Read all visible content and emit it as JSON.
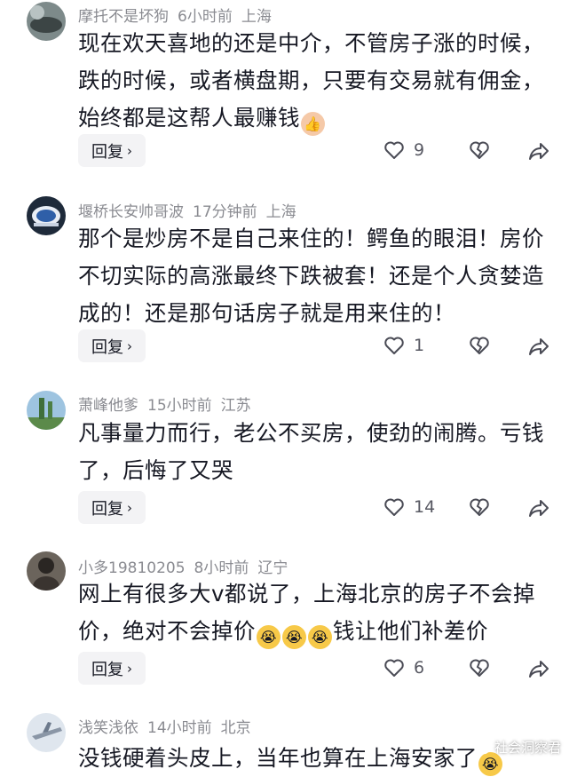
{
  "comments": [
    {
      "username": "摩托不是坏狗",
      "time": "6小时前",
      "location": "上海",
      "text": "现在欢天喜地的还是中介，不管房子涨的时候，跌的时候，或者横盘期，只要有交易就有佣金，始终都是这帮人最赚钱",
      "reply_label": "回复",
      "likes": "9"
    },
    {
      "username": "堰桥长安帅哥波",
      "time": "17分钟前",
      "location": "上海",
      "text": "那个是炒房不是自己来住的！鳄鱼的眼泪！房价不切实际的高涨最终下跌被套！还是个人贪婪造成的！还是那句话房子就是用来住的！",
      "reply_label": "回复",
      "likes": "1"
    },
    {
      "username": "萧峰他爹",
      "time": "15小时前",
      "location": "江苏",
      "text": "凡事量力而行，老公不买房，使劲的闹腾。亏钱了，后悔了又哭",
      "reply_label": "回复",
      "likes": "14"
    },
    {
      "username": "小多19810205",
      "time": "8小时前",
      "location": "辽宁",
      "text_before": "网上有很多大v都说了，上海北京的房子不会掉价，绝对不会掉价",
      "text_after": "钱让他们补差价",
      "reply_label": "回复",
      "likes": "6"
    },
    {
      "username": "浅笑浅依",
      "time": "14小时前",
      "location": "北京",
      "text": "没钱硬着头皮上，当年也算在上海安家了"
    }
  ],
  "watermark": "社会洞察君",
  "icons": {
    "like": "heart-outline-icon",
    "dislike": "broken-heart-icon",
    "share": "share-arrow-icon",
    "thumbs_up": "thumbs-up-emoji",
    "crying": "loudly-crying-emoji"
  }
}
